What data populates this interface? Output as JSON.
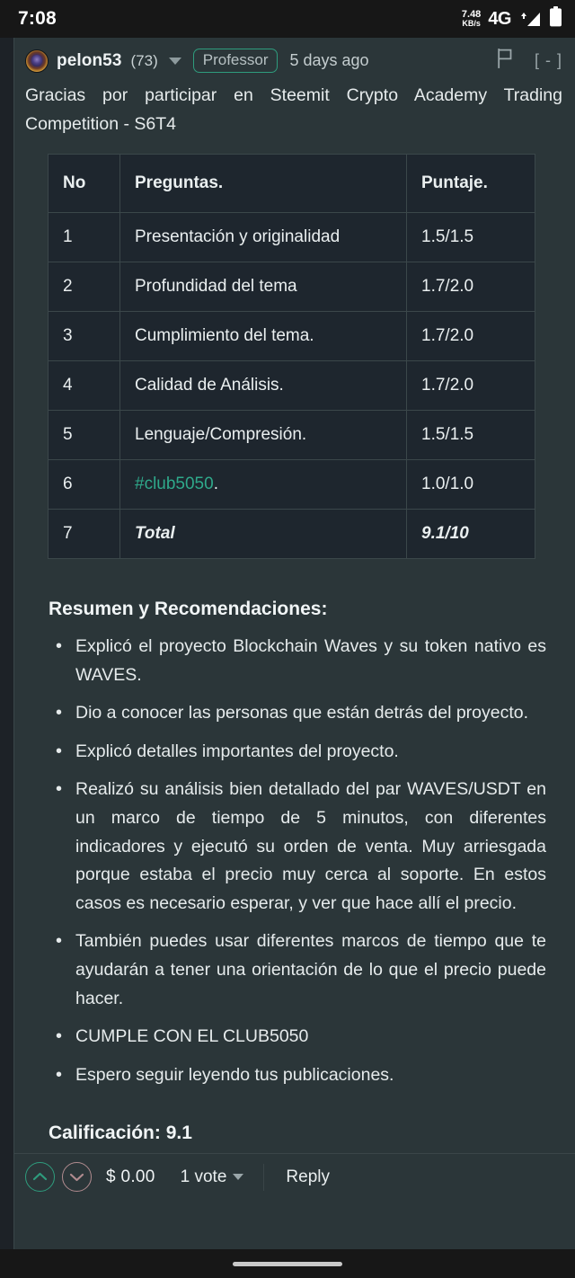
{
  "status_bar": {
    "time": "7:08",
    "net_speed_value": "7.48",
    "net_speed_unit": "KB/s",
    "network_type": "4G",
    "signal_icon": "signal-bars-icon",
    "battery_icon": "battery-full-icon"
  },
  "comment": {
    "avatar_name": "pelon53-avatar",
    "username": "pelon53",
    "reputation": "(73)",
    "badge": "Professor",
    "age": "5 days ago",
    "flag_icon": "flag-icon",
    "collapse_toggle": "[ - ]",
    "intro": "Gracias por participar en Steemit Crypto Academy Trading Competition - S6T4"
  },
  "table": {
    "headers": [
      "No",
      "Preguntas.",
      "Puntaje."
    ],
    "rows": [
      {
        "no": "1",
        "pregunta": "Presentación y originalidad",
        "puntaje": "1.5/1.5",
        "link": "",
        "total": false
      },
      {
        "no": "2",
        "pregunta": "Profundidad del tema",
        "puntaje": "1.7/2.0",
        "link": "",
        "total": false
      },
      {
        "no": "3",
        "pregunta": "Cumplimiento del tema.",
        "puntaje": "1.7/2.0",
        "link": "",
        "total": false
      },
      {
        "no": "4",
        "pregunta": "Calidad de Análisis.",
        "puntaje": "1.7/2.0",
        "link": "",
        "total": false
      },
      {
        "no": "5",
        "pregunta": "Lenguaje/Compresión.",
        "puntaje": "1.5/1.5",
        "link": "",
        "total": false
      },
      {
        "no": "6",
        "pregunta": ".",
        "puntaje": "1.0/1.0",
        "link": "#club5050",
        "total": false
      },
      {
        "no": "7",
        "pregunta": "Total",
        "puntaje": "9.1/10",
        "link": "",
        "total": true
      }
    ]
  },
  "summary": {
    "heading": "Resumen y Recomendaciones:",
    "items": [
      "Explicó el proyecto Blockchain Waves y su token nativo es WAVES.",
      "Dio a conocer las personas que están detrás del proyecto.",
      "Explicó detalles importantes del proyecto.",
      "Realizó su análisis bien detallado del par WAVES/USDT en un marco de tiempo de 5 minutos, con diferentes indicadores y ejecutó su orden de venta. Muy arriesgada porque estaba el precio muy cerca al soporte. En estos casos es necesario esperar, y ver que hace allí el precio.",
      "También puedes usar diferentes marcos de tiempo que te ayudarán a tener una orientación de lo que el precio puede hacer.",
      "CUMPLE CON EL CLUB5050",
      "Espero seguir leyendo tus publicaciones."
    ]
  },
  "rating_line": "Calificación: 9.1",
  "footer": {
    "upvote_icon": "chevron-up-icon",
    "downvote_icon": "chevron-down-icon",
    "payout": "$ 0.00",
    "votes": "1 vote",
    "votes_caret_icon": "caret-down-icon",
    "reply": "Reply"
  },
  "colors": {
    "accent_teal": "#2e9c7d",
    "downvote": "#b08b8f",
    "card_bg": "#2b3639",
    "table_bg": "#1e262e",
    "statusbar_bg": "#171717"
  }
}
